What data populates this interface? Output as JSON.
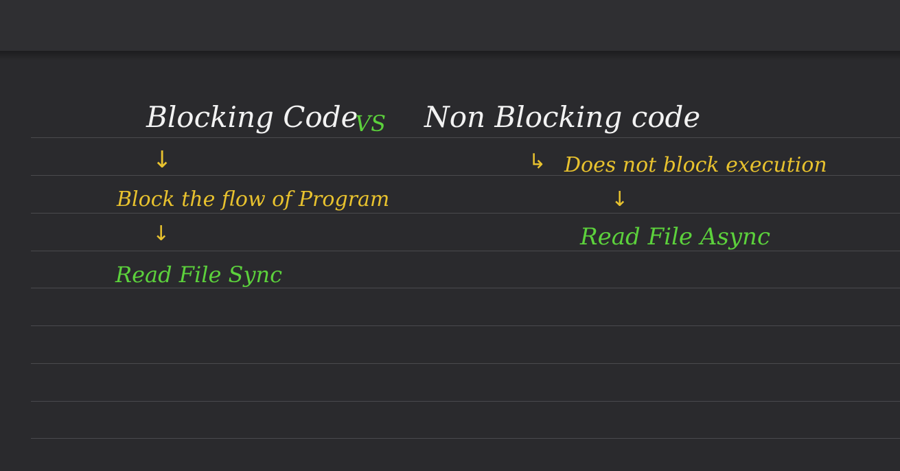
{
  "note": {
    "title_left": "Blocking Code",
    "title_vs": "VS",
    "title_right": "Non Blocking code",
    "left_description": "Block the flow of Program",
    "left_example": "Read File Sync",
    "right_description": "Does not block execution",
    "right_example": "Read File Async"
  },
  "arrows": {
    "down": "↓",
    "hook": "↳"
  },
  "colors": {
    "background": "#2a2a2d",
    "toolbar": "#2f2f32",
    "rule_line": "#4a4a4e",
    "ink_white": "#f2f2f2",
    "ink_yellow": "#e8c22e",
    "ink_green": "#5cd13c"
  }
}
